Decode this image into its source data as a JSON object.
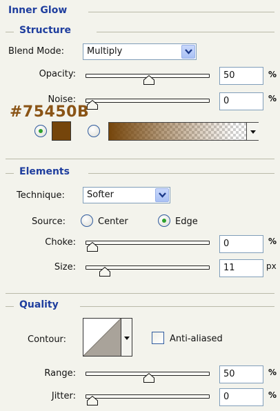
{
  "section_title": "Inner Glow",
  "structure": {
    "title": "Structure",
    "blend_mode_label": "Blend Mode:",
    "blend_mode_value": "Multiply",
    "opacity_label": "Opacity:",
    "opacity_value": "50",
    "opacity_unit": "%",
    "opacity_level": 0.5,
    "noise_label": "Noise:",
    "noise_value": "0",
    "noise_unit": "%",
    "noise_level": 0,
    "color_annotation": "#75450B",
    "glow_color": "#75450B",
    "color_mode": "solid"
  },
  "elements": {
    "title": "Elements",
    "technique_label": "Technique:",
    "technique_value": "Softer",
    "source_label": "Source:",
    "source_options": [
      "Center",
      "Edge"
    ],
    "source_selected": "Edge",
    "choke_label": "Choke:",
    "choke_value": "0",
    "choke_unit": "%",
    "choke_level": 0,
    "size_label": "Size:",
    "size_value": "11",
    "size_unit": "px",
    "size_level": 0.11
  },
  "quality": {
    "title": "Quality",
    "contour_label": "Contour:",
    "anti_aliased_label": "Anti-aliased",
    "anti_aliased_checked": false,
    "range_label": "Range:",
    "range_value": "50",
    "range_unit": "%",
    "range_level": 0.5,
    "jitter_label": "Jitter:",
    "jitter_value": "0",
    "jitter_unit": "%",
    "jitter_level": 0
  }
}
